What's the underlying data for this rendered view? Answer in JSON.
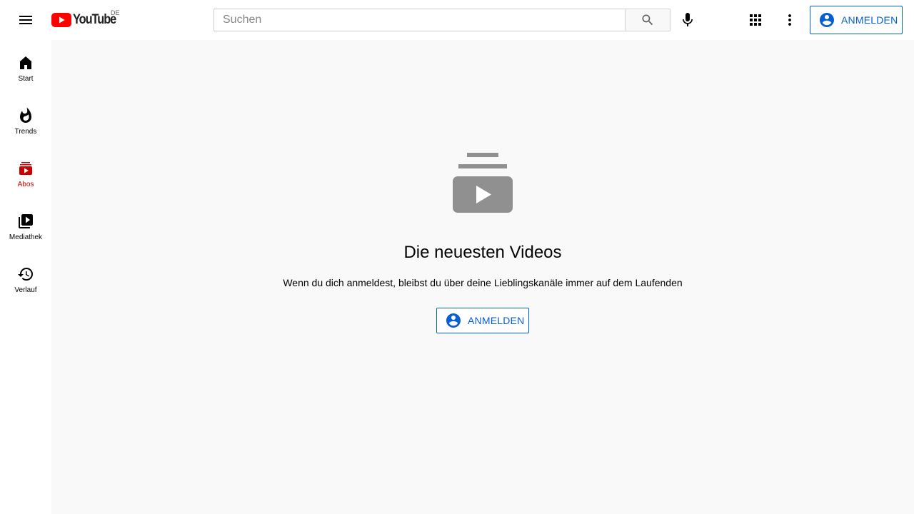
{
  "header": {
    "logo_text": "YouTube",
    "country_code": "DE",
    "search_placeholder": "Suchen",
    "signin_label": "ANMELDEN"
  },
  "sidebar": {
    "items": [
      {
        "label": "Start",
        "icon": "home-icon",
        "active": false
      },
      {
        "label": "Trends",
        "icon": "flame-icon",
        "active": false
      },
      {
        "label": "Abos",
        "icon": "subscriptions-icon",
        "active": true
      },
      {
        "label": "Mediathek",
        "icon": "library-icon",
        "active": false
      },
      {
        "label": "Verlauf",
        "icon": "history-icon",
        "active": false
      }
    ]
  },
  "main": {
    "title": "Die neuesten Videos",
    "subtitle": "Wenn du dich anmeldest, bleibst du über deine Lieblingskanäle immer auf dem Laufenden",
    "signin_label": "ANMELDEN"
  },
  "colors": {
    "brand_red": "#ff0000",
    "active_red": "#cc0000",
    "link_blue": "#065fd4",
    "main_bg": "#f9f9f9",
    "icon_gray": "#909090"
  }
}
